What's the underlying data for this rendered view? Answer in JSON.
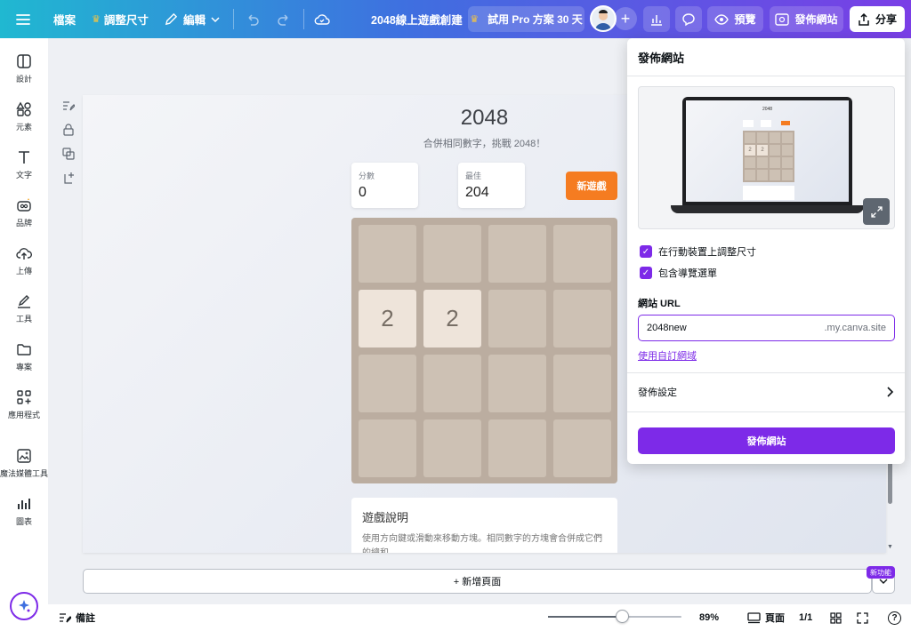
{
  "topbar": {
    "file_label": "檔案",
    "resize_label": "調整尺寸",
    "edit_label": "編輯",
    "doc_title": "2048線上遊戲創建",
    "pro_trial_label": "試用 Pro 方案 30 天",
    "preview_label": "預覽",
    "publish_site_label": "發佈網站",
    "share_label": "分享"
  },
  "sidebar": {
    "items": [
      {
        "label": "設計"
      },
      {
        "label": "元素"
      },
      {
        "label": "文字"
      },
      {
        "label": "品牌"
      },
      {
        "label": "上傳"
      },
      {
        "label": "工具"
      },
      {
        "label": "專案"
      },
      {
        "label": "應用程式"
      },
      {
        "label": "魔法媒體工具"
      },
      {
        "label": "圖表"
      }
    ]
  },
  "game": {
    "title": "2048",
    "subtitle": "合併相同數字，挑戰 2048！",
    "score_label": "分數",
    "score_value": "0",
    "best_label": "最佳",
    "best_value": "204",
    "new_game_label": "新遊戲",
    "tiles": [
      "",
      "",
      "",
      "",
      "2",
      "2",
      "",
      "",
      "",
      "",
      "",
      "",
      "",
      "",
      "",
      ""
    ],
    "info_title": "遊戲說明",
    "info_text": "使用方向鍵或滑動來移動方塊。相同數字的方塊會合併成它們的總和。"
  },
  "canvas": {
    "add_page_label": "+ 新增頁面",
    "new_feature_badge": "新功能"
  },
  "bottombar": {
    "notes_label": "備註",
    "zoom_level": "89%",
    "zoom_fraction": 0.55,
    "pages_label": "頁面",
    "page_count": "1/1",
    "help_label": "?"
  },
  "publish_panel": {
    "title": "發佈網站",
    "option_resize_mobile": "在行動裝置上調整尺寸",
    "option_include_nav": "包含導覽選單",
    "url_label": "網站 URL",
    "url_value": "2048new",
    "url_suffix": ".my.canva.site",
    "custom_domain_link": "使用自訂網域",
    "settings_label": "發佈設定",
    "publish_button": "發佈網站"
  }
}
